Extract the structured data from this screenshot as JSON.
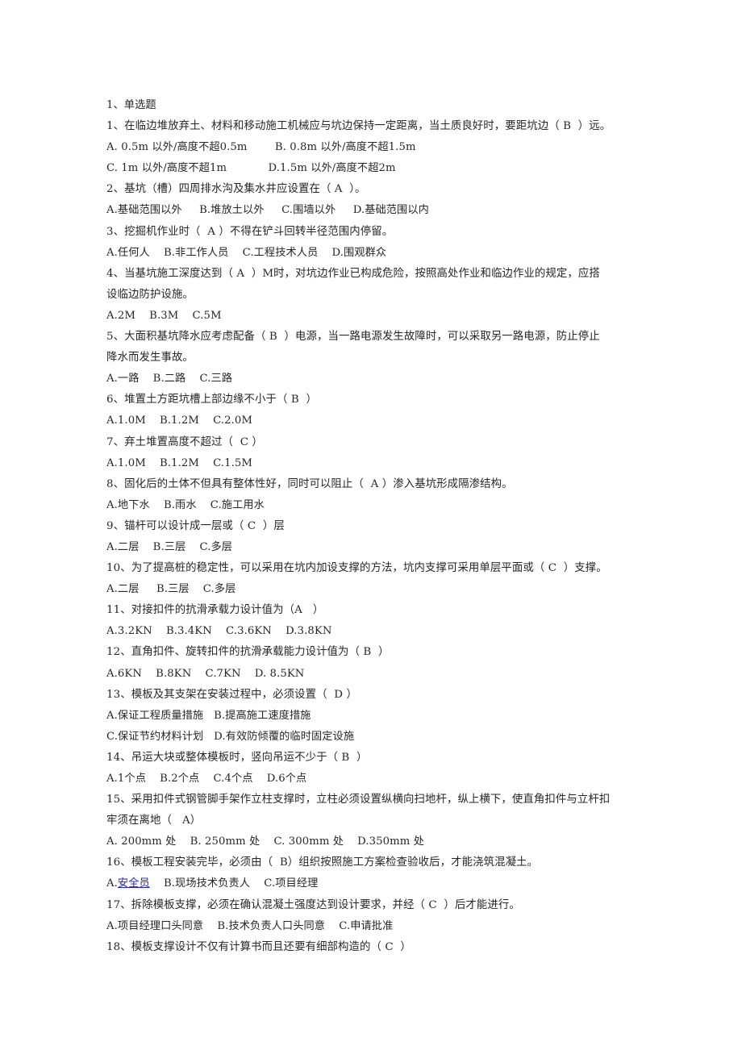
{
  "document": {
    "section_title": "1、单选题",
    "questions": [
      {
        "number": "1",
        "stem": "1、在临边堆放弃土、材料和移动施工机械应与坑边保持一定距离，当土质良好时，要距坑边（ B  ）远。",
        "answer": "B",
        "option_lines": [
          "A. 0.5m 以外/高度不超0.5m        B. 0.8m 以外/高度不超1.5m",
          "C. 1m 以外/高度不超1m            D.1.5m 以外/高度不超2m"
        ]
      },
      {
        "number": "2",
        "stem": "2、基坑（槽）四周排水沟及集水井应设置在（ A  ）。",
        "answer": "A",
        "option_lines": [
          "A.基础范围以外     B.堆放土以外     C.围墙以外     D.基础范围以内"
        ]
      },
      {
        "number": "3",
        "stem": "3、挖掘机作业时（  A ）不得在铲斗回转半径范围内停留。",
        "answer": "A",
        "option_lines": [
          "A.任何人    B.非工作人员    C.工程技术人员    D.围观群众"
        ]
      },
      {
        "number": "4",
        "stem": "4、当基坑施工深度达到（ A  ）M时，对坑边作业已构成危险，按照高处作业和临边作业的规定，应搭",
        "stem_cont": "设临边防护设施。",
        "answer": "A",
        "option_lines": [
          "A.2M    B.3M    C.5M"
        ]
      },
      {
        "number": "5",
        "stem": "5、大面积基坑降水应考虑配备（ B  ）电源，当一路电源发生故障时，可以采取另一路电源，防止停止",
        "stem_cont": "降水而发生事故。",
        "answer": "B",
        "option_lines": [
          "A.一路    B.二路    C.三路"
        ]
      },
      {
        "number": "6",
        "stem": "6、堆置土方距坑槽上部边缘不小于（ B  ）",
        "answer": "B",
        "option_lines": [
          "A.1.0M    B.1.2M    C.2.0M"
        ]
      },
      {
        "number": "7",
        "stem": "7、弃土堆置高度不超过（  C ）",
        "answer": "C",
        "option_lines": [
          "A.1.0M    B.1.2M    C.1.5M"
        ]
      },
      {
        "number": "8",
        "stem": "8、固化后的土体不但具有整体性好，同时可以阻止（  A ）渗入基坑形成隔渗结构。",
        "answer": "A",
        "option_lines": [
          "A.地下水    B.雨水    C.施工用水"
        ]
      },
      {
        "number": "9",
        "stem": "9、锚杆可以设计成一层或（ C  ）层",
        "answer": "C",
        "option_lines": [
          "A.二层    B.三层    C.多层"
        ]
      },
      {
        "number": "10",
        "stem": "10、为了提高桩的稳定性，可以采用在坑内加设支撑的方法，坑内支撑可采用单层平面或（ C  ）支撑。",
        "answer": "C",
        "option_lines": [
          "A.二层     B.三层    C.多层"
        ]
      },
      {
        "number": "11",
        "stem": "11、对接扣件的抗滑承载力设计值为（A   ）",
        "answer": "A",
        "option_lines": [
          "A.3.2KN    B.3.4KN    C.3.6KN    D.3.8KN"
        ]
      },
      {
        "number": "12",
        "stem": "12、直角扣件、旋转扣件的抗滑承载能力设计值为（ B  ）",
        "answer": "B",
        "option_lines": [
          "A.6KN    B.8KN    C.7KN    D. 8.5KN"
        ]
      },
      {
        "number": "13",
        "stem": "13、模板及其支架在安装过程中，必须设置（  D ）",
        "answer": "D",
        "option_lines": [
          "A.保证工程质量措施   B.提高施工速度措施",
          "C.保证节约材料计划   D.有效防倾覆的临时固定设施"
        ]
      },
      {
        "number": "14",
        "stem": "14、吊运大块或整体模板时，竖向吊运不少于（ B  ）",
        "answer": "B",
        "option_lines": [
          "A.1个点    B.2个点    C.4个点    D.6个点"
        ]
      },
      {
        "number": "15",
        "stem": "15、采用扣件式钢管脚手架作立柱支撑时，立柱必须设置纵横向扫地杆，纵上横下，使直角扣件与立杆扣",
        "stem_cont": "牢须在离地（   A）",
        "answer": "A",
        "option_lines": [
          "A. 200mm 处    B. 250mm 处    C. 300mm 处    D.350mm 处"
        ]
      },
      {
        "number": "16",
        "stem": "16、模板工程安装完毕，必须由（  B）组织按照施工方案检查验收后，才能浇筑混凝土。",
        "answer": "B",
        "option_lines": [
          "A.安全员    B.现场技术负责人    C.项目经理"
        ],
        "option_link": {
          "prefix": "A.",
          "link_text": "安全员",
          "suffix": "    B.现场技术负责人    C.项目经理"
        }
      },
      {
        "number": "17",
        "stem": "17、拆除模板支撑，必须在确认混凝土强度达到设计要求，并经（ C  ）后才能进行。",
        "answer": "C",
        "option_lines": [
          "A.项目经理口头同意    B.技术负责人口头同意    C.申请批准"
        ]
      },
      {
        "number": "18",
        "stem": "18、模板支撑设计不仅有计算书而且还要有细部构造的（ C  ）",
        "answer": "C",
        "option_lines": []
      }
    ]
  },
  "colors": {
    "text": "#262626",
    "link": "#2222cc",
    "background": "#ffffff"
  }
}
